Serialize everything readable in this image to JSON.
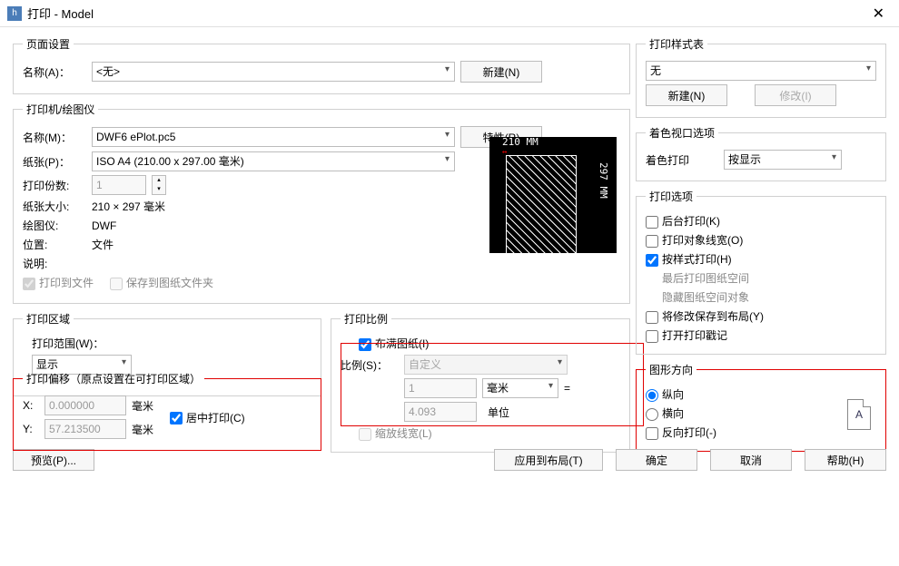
{
  "titlebar": {
    "title": "打印 - Model"
  },
  "page_setup": {
    "legend": "页面设置",
    "name_label": "名称(A)：",
    "name_value": "<无>",
    "new_btn": "新建(N)"
  },
  "printer": {
    "legend": "打印机/绘图仪",
    "name_label": "名称(M)：",
    "name_value": "DWF6 ePlot.pc5",
    "props_btn": "特性(R)",
    "paper_label": "纸张(P)：",
    "paper_value": "ISO A4 (210.00 x 297.00 毫米)",
    "copies_label": "打印份数:",
    "copies_value": "1",
    "size_label": "纸张大小:",
    "size_value": "210 × 297 毫米",
    "plotter_label": "绘图仪:",
    "plotter_value": "DWF",
    "location_label": "位置:",
    "location_value": "文件",
    "desc_label": "说明:",
    "print_to_file": "打印到文件",
    "save_to_folder": "保存到图纸文件夹",
    "preview_w": "210 MM",
    "preview_h": "297 MM"
  },
  "area": {
    "legend": "打印区域",
    "scope_label": "打印范围(W)：",
    "scope_value": "显示"
  },
  "offset": {
    "legend": "打印偏移（原点设置在可打印区域）",
    "x_label": "X:",
    "x_value": "0.000000",
    "y_label": "Y:",
    "y_value": "57.213500",
    "unit": "毫米",
    "center": "居中打印(C)"
  },
  "scale": {
    "legend": "打印比例",
    "fit": "布满图纸(I)",
    "ratio_label": "比例(S)：",
    "ratio_value": "自定义",
    "num1": "1",
    "unit_sel": "毫米",
    "eq": "=",
    "num2": "4.093",
    "unit_label": "单位",
    "scale_lw": "缩放线宽(L)"
  },
  "style": {
    "legend": "打印样式表",
    "none": "无",
    "new_btn": "新建(N)",
    "edit_btn": "修改(I)"
  },
  "viewport": {
    "legend": "着色视口选项",
    "shade_label": "着色打印",
    "shade_value": "按显示"
  },
  "options": {
    "legend": "打印选项",
    "bg": "后台打印(K)",
    "lw": "打印对象线宽(O)",
    "bystyle": "按样式打印(H)",
    "last": "最后打印图纸空间",
    "hide": "隐藏图纸空间对象",
    "save_layout": "将修改保存到布局(Y)",
    "stamp": "打开打印戳记"
  },
  "orient": {
    "legend": "图形方向",
    "portrait": "纵向",
    "landscape": "横向",
    "reverse": "反向打印(-)",
    "icon_letter": "A"
  },
  "footer": {
    "preview": "预览(P)...",
    "apply": "应用到布局(T)",
    "ok": "确定",
    "cancel": "取消",
    "help": "帮助(H)"
  }
}
